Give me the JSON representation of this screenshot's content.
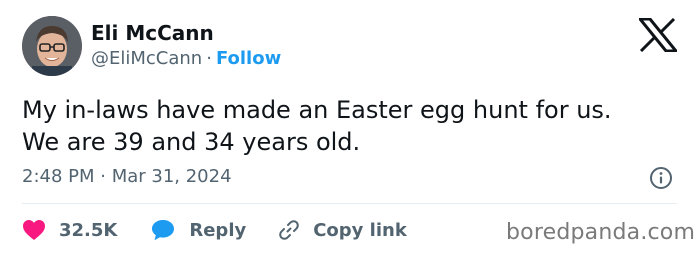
{
  "author": {
    "name": "Eli McCann",
    "handle": "@EliMcCann",
    "separator": "·",
    "follow_label": "Follow"
  },
  "tweet": {
    "lines": [
      "My in-laws have made an Easter egg hunt for us.",
      "We are 39 and 34 years old."
    ],
    "timestamp": "2:48 PM · Mar 31, 2024"
  },
  "actions": {
    "like_count": "32.5K",
    "reply_label": "Reply",
    "copy_link_label": "Copy link"
  },
  "icons": {
    "brand": "x-logo-icon",
    "info": "info-icon",
    "like": "heart-icon",
    "reply": "speech-bubble-icon",
    "copy": "link-icon"
  },
  "colors": {
    "text": "#0f1419",
    "secondary": "#536471",
    "accent": "#1d9bf0",
    "heart": "#f91880",
    "divider": "#e6ecf0"
  },
  "watermark": "boredpanda.com"
}
